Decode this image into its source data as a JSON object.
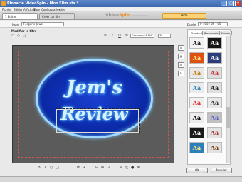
{
  "window": {
    "title": "Pinnacle VideoSpin - Mon Film.stx *",
    "buttons": {
      "minimize": "_",
      "maximize": "□",
      "close": "×"
    }
  },
  "menu": [
    "Fichier",
    "Edition",
    "Affichage",
    "Titre",
    "Configuration",
    "Aide"
  ],
  "steps": [
    {
      "label": "1  Editer"
    },
    {
      "label": "Créer un film"
    }
  ],
  "brand": {
    "name": "Video",
    "accent": "Spin",
    "tagline": "BY AVIDVIDEO"
  },
  "aide_button": "Aide",
  "name_row": {
    "label": "Nom",
    "value": "Forgerie Jews",
    "duration_label": "Durée",
    "duration_value": "0 : 00 : 05 : 00"
  },
  "editor": {
    "title": "Modifier le titre",
    "font": "Garamond 8 ENT",
    "size": "35",
    "title_lines": [
      "Jem's",
      "Review"
    ]
  },
  "style_tabs": [
    "Standard",
    "Personnalisé",
    "Favoris"
  ],
  "swatch_sample": "Aa",
  "swatches": [
    {
      "bg": "#f2f2f2",
      "fg": "#222"
    },
    {
      "bg": "#151515",
      "fg": "#f4f4f4"
    },
    {
      "bg": "#e05010",
      "fg": "#ffe38a"
    },
    {
      "bg": "#2c3c7a",
      "fg": "#f2f2f2"
    },
    {
      "bg": "#e8e8e8",
      "fg": "#c08010"
    },
    {
      "bg": "#dedede",
      "fg": "#c33"
    },
    {
      "bg": "#ebebeb",
      "fg": "#2a8abf"
    },
    {
      "bg": "#dfdfdf",
      "fg": "#1b1b1b"
    },
    {
      "bg": "#f0f0f0",
      "fg": "#d33"
    },
    {
      "bg": "#e7e7e7",
      "fg": "#333"
    },
    {
      "bg": "#ececec",
      "fg": "#0a0a0a"
    },
    {
      "bg": "#c0c0c0",
      "fg": "#5a5ad0"
    },
    {
      "bg": "#1b1b1b",
      "fg": "#f4f4f4"
    },
    {
      "bg": "#e3e3e3",
      "fg": "#aa3030"
    },
    {
      "bg": "#2d7fb8",
      "fg": "#ffe38a"
    },
    {
      "bg": "#e2e2e2",
      "fg": "#7a3a10"
    }
  ],
  "footer": {
    "ok": "OK",
    "cancel": "Annuler"
  }
}
